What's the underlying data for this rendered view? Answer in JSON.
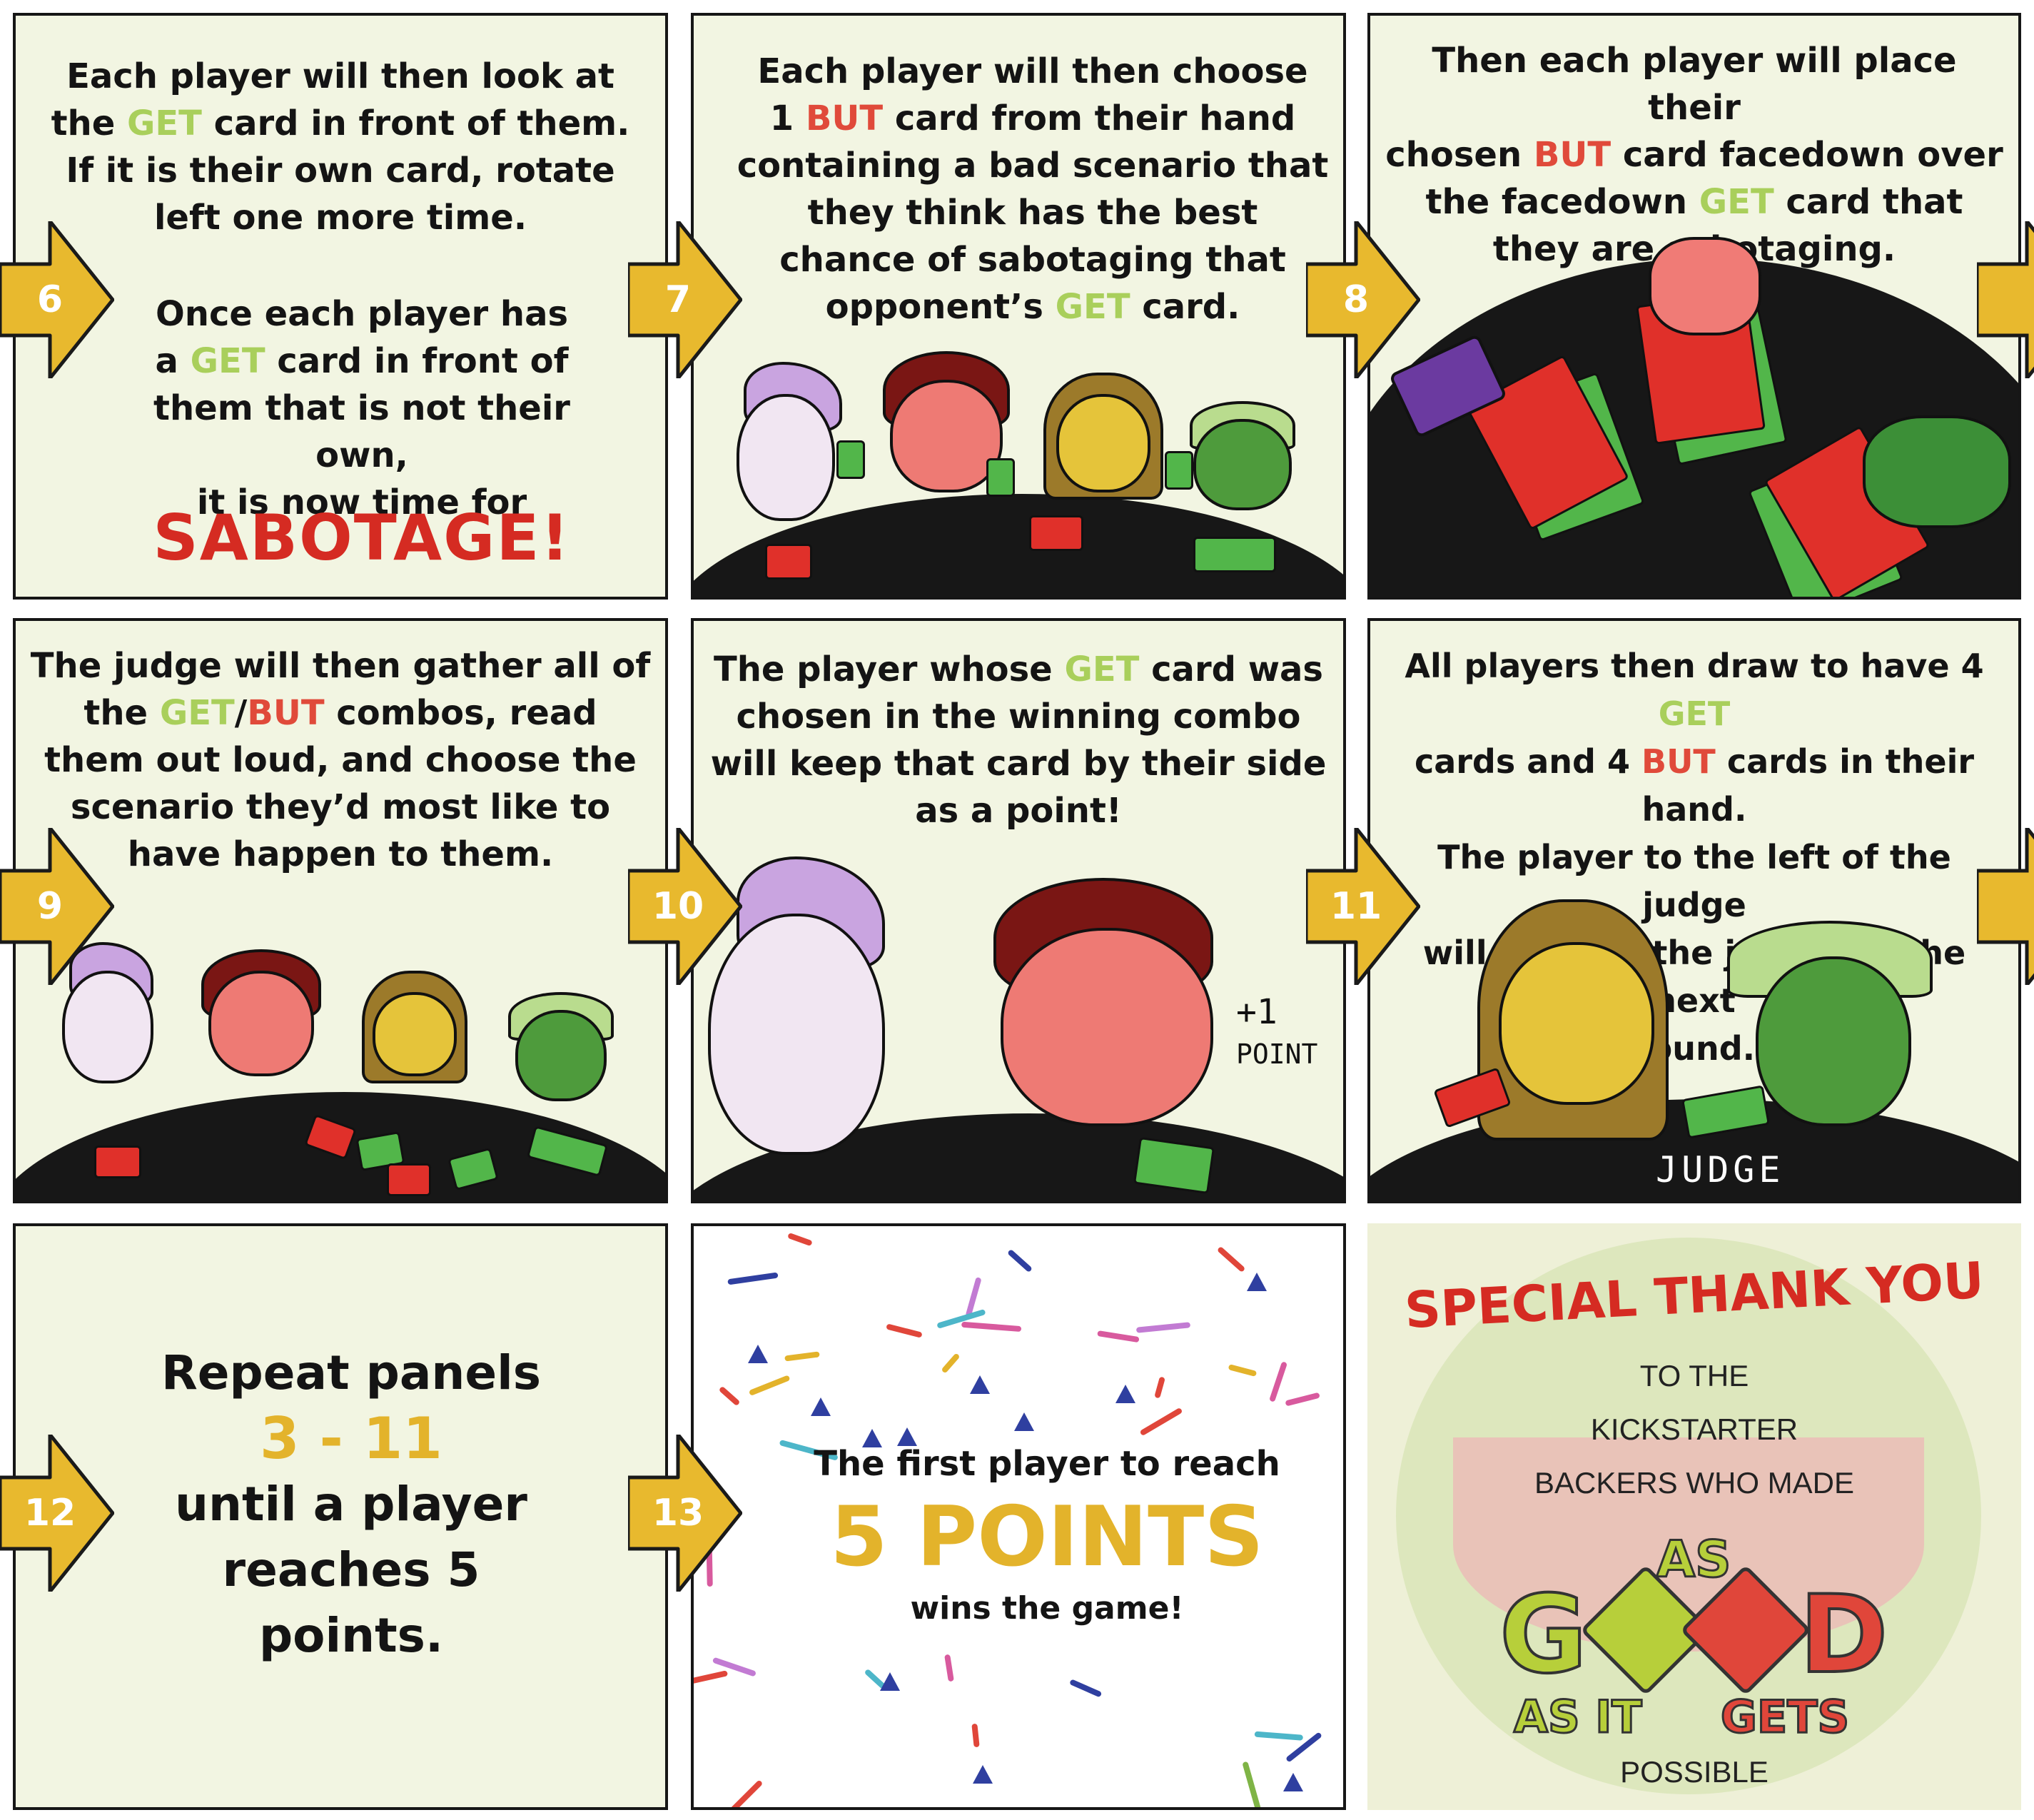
{
  "panels": {
    "p6": {
      "number": "6",
      "line1a": "Each player will then look at",
      "line2a": "the ",
      "line2get": "GET",
      "line2b": " card in front of them.",
      "line3": "If it is their own card, rotate",
      "line4": "left one more time.",
      "line5": "Once each player has",
      "line6a": "a ",
      "line6get": "GET",
      "line6b": " card in front of",
      "line7": "them that is not their own,",
      "line8": "it is now time for",
      "sabotage": "SABOTAGE!"
    },
    "p7": {
      "number": "7",
      "line1": "Each player will then choose",
      "line2a": "1 ",
      "line2but": "BUT",
      "line2b": " card from their hand",
      "line3": "containing a bad scenario that",
      "line4": "they think has the best",
      "line5": "chance of sabotaging that",
      "line6a": "opponent’s ",
      "line6get": "GET",
      "line6b": " card."
    },
    "p8": {
      "number": "8",
      "line1": "Then each player will place their",
      "line2a": "chosen ",
      "line2but": "BUT",
      "line2b": " card facedown over",
      "line3a": "the facedown ",
      "line3get": "GET",
      "line3b": " card that",
      "line4": "they are sabotaging."
    },
    "p9": {
      "number": "9",
      "line1": "The judge will then gather all of",
      "line2a": "the ",
      "line2get": "GET",
      "line2slash": "/",
      "line2but": "BUT",
      "line2b": " combos, read",
      "line3": "them out loud, and choose the",
      "line4": "scenario they’d most like to",
      "line5": "have happen to them."
    },
    "p10": {
      "number": "10",
      "line1a": "The player whose ",
      "line1get": "GET",
      "line1b": " card was",
      "line2": "chosen in the winning combo",
      "line3": "will keep that card by their side",
      "line4": "as a point!",
      "plus": "+1",
      "point": "POINT"
    },
    "p11": {
      "number": "11",
      "line1a": "All players then draw to have 4 ",
      "line1get": "GET",
      "line2a": "cards and 4 ",
      "line2but": "BUT",
      "line2b": " cards in their hand.",
      "line3": "The player to the left of the judge",
      "line4": "will then be the judge for the next",
      "line5": "round.",
      "judge": "JUDGE"
    },
    "p12": {
      "number": "12",
      "line1": "Repeat panels",
      "line2": "3 - 11",
      "line3": "until a player",
      "line4": "reaches 5",
      "line5": "points."
    },
    "p13": {
      "number": "13",
      "line1": "The first player to reach",
      "big": "5 POINTS",
      "line3": "wins the game!"
    }
  },
  "thanks": {
    "title": "SPECIAL THANK YOU",
    "line1": "TO THE",
    "line2": "KICKSTARTER",
    "line3": "BACKERS WHO MADE",
    "logo_top": "AS",
    "logo_g": "G",
    "logo_d": "D",
    "logo_bottom_left": "AS IT",
    "logo_bottom_right": "GETS",
    "line4": "POSSIBLE"
  },
  "colors": {
    "panel_bg": "#f2f5e2",
    "get": "#a9cf5b",
    "but": "#e04a3a",
    "arrow": "#e8b92e",
    "sabotage": "#d52b22",
    "table": "#171717"
  }
}
